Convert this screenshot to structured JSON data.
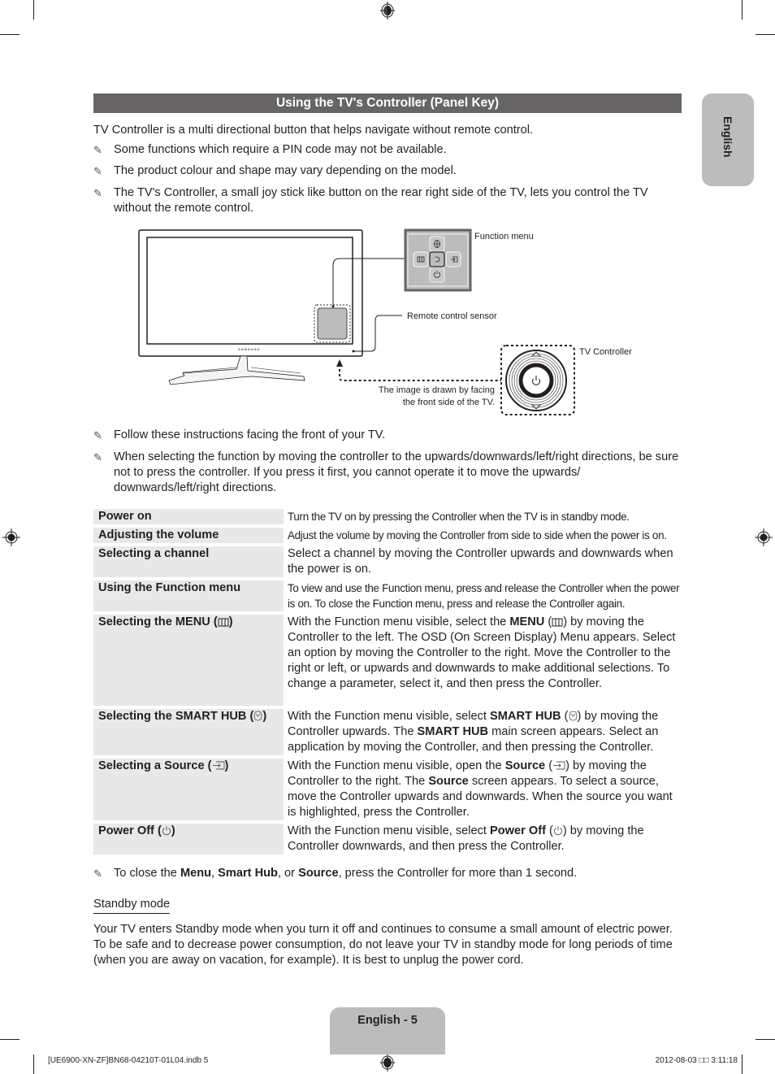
{
  "header": {
    "title": "Using the TV's Controller (Panel Key)",
    "side_tab": "English"
  },
  "intro": "TV Controller is a multi directional button that helps navigate without remote control.",
  "notes_top": [
    "Some functions which require a PIN code may not be available.",
    "The product colour and shape may vary depending on the model.",
    "The TV's Controller, a small joy stick like button on the rear right side of the TV, lets you control the TV without the remote control."
  ],
  "diagram": {
    "brand_label": "SAMSUNG",
    "function_menu_label": "Function menu",
    "remote_sensor_label": "Remote control sensor",
    "tv_controller_label": "TV Controller",
    "facing_note_line1": "The image is drawn by facing",
    "facing_note_line2": "the front side of the TV.",
    "function_menu_icons": {
      "up": "smart-hub-icon",
      "left": "menu-icon",
      "center": "return-icon",
      "right": "source-icon",
      "down": "power-icon"
    }
  },
  "notes_mid": [
    "Follow these instructions facing the front of your TV.",
    "When selecting the function by moving the controller to the upwards/downwards/left/right directions, be sure not to press the controller. If you press it first, you cannot operate it to move the upwards/ downwards/left/right directions."
  ],
  "table": [
    {
      "key": "Power on",
      "value": "Turn the TV on by pressing the Controller when the TV is in standby mode."
    },
    {
      "key": "Adjusting the volume",
      "value": "Adjust the volume by moving the Controller from side to side when the power is on."
    },
    {
      "key": "Selecting a channel",
      "value": "Select a channel by moving the Controller upwards and downwards when the power is on."
    },
    {
      "key": "Using the Function menu",
      "value": "To view and use the Function menu, press and release the Controller when the power is on. To close the Function menu, press and release the Controller again."
    },
    {
      "key": "Selecting the MENU (",
      "key_end": ")",
      "icon": "menu-icon",
      "v_pre": "With the Function menu visible, select the ",
      "v_bold": "MENU",
      "v_mid": " (",
      "v_post": ") by moving the Controller to the left. The OSD (On Screen Display) Menu appears. Select an option by moving the Controller to the right. Move the Controller to the right or left, or upwards and downwards to make additional selections. To change a parameter, select it, and then press the Controller."
    },
    {
      "key": "Selecting the SMART HUB (",
      "key_end": ")",
      "icon": "smart-hub-icon",
      "v_pre": "With the Function menu visible, select ",
      "v_bold": "SMART HUB",
      "v_mid": " (",
      "v_post": ") by moving the Controller upwards. The ",
      "v_bold2": "SMART HUB",
      "v_post2": " main screen appears. Select an application by moving the Controller, and then pressing the Controller."
    },
    {
      "key": "Selecting a Source (",
      "key_end": ")",
      "icon": "source-icon",
      "v_pre": "With the Function menu visible, open the ",
      "v_bold": "Source",
      "v_mid": " (",
      "v_post": ") by moving the Controller to the right. The ",
      "v_bold2": "Source",
      "v_post2": " screen appears. To select a source, move the Controller upwards and downwards. When the source you want is highlighted, press the Controller."
    },
    {
      "key": "Power Off (",
      "key_end": ")",
      "icon": "power-icon",
      "v_pre": "With the Function menu visible, select ",
      "v_bold": "Power Off",
      "v_mid": " (",
      "v_post": ") by moving the Controller downwards, and then press the Controller."
    }
  ],
  "close_note": {
    "pre": "To close the ",
    "b1": "Menu",
    "sep1": ", ",
    "b2": "Smart Hub",
    "sep2": ", or ",
    "b3": "Source",
    "post": ", press the Controller for more than 1 second."
  },
  "standby": {
    "heading": "Standby mode",
    "body": "Your TV enters Standby mode when you turn it off and continues to consume a small amount of electric power. To be safe and to decrease power consumption, do not leave your TV in standby mode for long periods of time (when you are away on vacation, for example). It is best to unplug the power cord."
  },
  "footer": {
    "page_label": "English - 5",
    "slug_left": "[UE6900-XN-ZF]BN68-04210T-01L04.indb   5",
    "slug_right": "2012-08-03   □□ 3:11:18"
  },
  "note_icon": "pencil-note-icon"
}
